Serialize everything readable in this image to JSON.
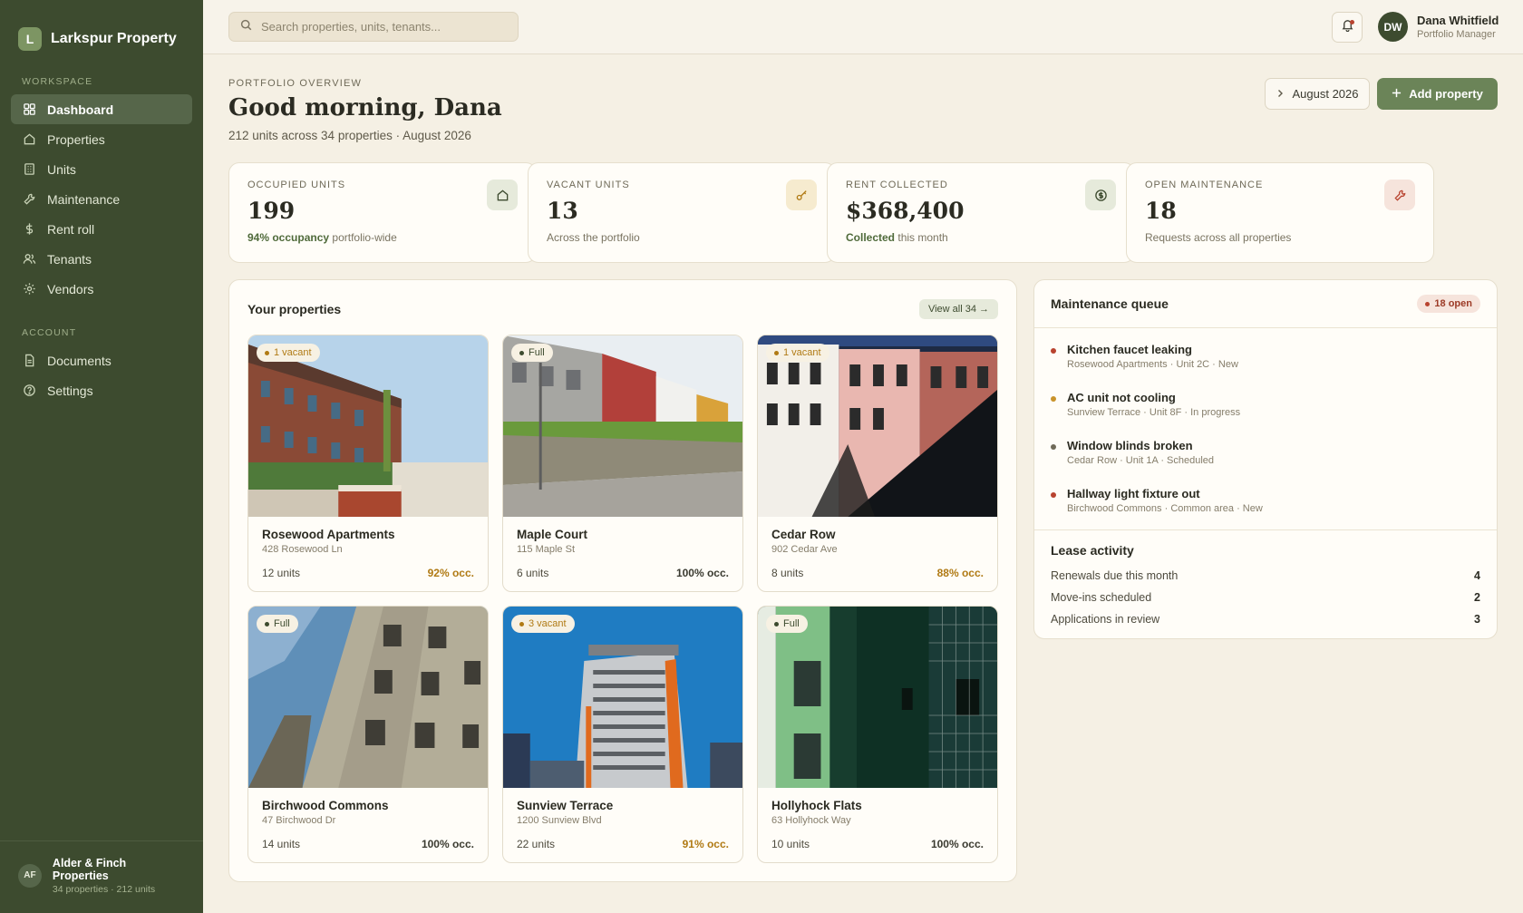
{
  "brand": {
    "initial": "L",
    "name": "Larkspur Property"
  },
  "sidebar": {
    "workspace_label": "WORKSPACE",
    "workspace_items": [
      {
        "label": "Dashboard",
        "icon": "grid-icon",
        "active": true
      },
      {
        "label": "Properties",
        "icon": "home-icon"
      },
      {
        "label": "Units",
        "icon": "building-icon"
      },
      {
        "label": "Maintenance",
        "icon": "wrench-icon"
      },
      {
        "label": "Rent roll",
        "icon": "dollar-icon"
      },
      {
        "label": "Tenants",
        "icon": "users-icon"
      },
      {
        "label": "Vendors",
        "icon": "gear-icon"
      }
    ],
    "account_label": "ACCOUNT",
    "account_items": [
      {
        "label": "Documents",
        "icon": "document-icon"
      },
      {
        "label": "Settings",
        "icon": "help-icon"
      }
    ],
    "footer": {
      "initials": "AF",
      "name": "Alder & Finch Properties",
      "sub": "34 properties · 212 units"
    }
  },
  "topbar": {
    "search_placeholder": "Search properties, units, tenants...",
    "user": {
      "initials": "DW",
      "name": "Dana Whitfield",
      "role": "Portfolio Manager"
    }
  },
  "header": {
    "eyebrow": "PORTFOLIO OVERVIEW",
    "greeting": "Good morning, Dana",
    "subline": "212 units across 34 properties · August 2026",
    "month_button": "August 2026",
    "add_button": "Add property"
  },
  "stats": [
    {
      "label": "OCCUPIED UNITS",
      "value": "199",
      "note_strong": "94% occupancy",
      "note": "portfolio-wide",
      "icon": "home-icon",
      "icon_bg": "#e6eadb",
      "icon_color": "#3d4b2f"
    },
    {
      "label": "VACANT UNITS",
      "value": "13",
      "note_strong": "",
      "note": "Across the portfolio",
      "icon": "key-icon",
      "icon_bg": "#f6ebcf",
      "icon_color": "#b07a14"
    },
    {
      "label": "RENT COLLECTED",
      "value": "$368,400",
      "note_strong": "Collected",
      "note": "this month",
      "icon": "dollar-circle-icon",
      "icon_bg": "#e6eadb",
      "icon_color": "#3d4b2f"
    },
    {
      "label": "OPEN MAINTENANCE",
      "value": "18",
      "note_strong": "",
      "note": "Requests across all properties",
      "icon": "wrench-icon",
      "icon_bg": "#f6e4dc",
      "icon_color": "#b8432f"
    }
  ],
  "properties_panel": {
    "title": "Your properties",
    "view_all": "View all 34 →",
    "items": [
      {
        "name": "Rosewood Apartments",
        "address": "428 Rosewood Ln",
        "units": "12 units",
        "occupancy": "92% occ.",
        "badge": "1 vacant",
        "status": "vacant"
      },
      {
        "name": "Maple Court",
        "address": "115 Maple St",
        "units": "6 units",
        "occupancy": "100% occ.",
        "badge": "Full",
        "status": "full"
      },
      {
        "name": "Cedar Row",
        "address": "902 Cedar Ave",
        "units": "8 units",
        "occupancy": "88% occ.",
        "badge": "1 vacant",
        "status": "vacant"
      },
      {
        "name": "Birchwood Commons",
        "address": "47 Birchwood Dr",
        "units": "14 units",
        "occupancy": "100% occ.",
        "badge": "Full",
        "status": "full"
      },
      {
        "name": "Sunview Terrace",
        "address": "1200 Sunview Blvd",
        "units": "22 units",
        "occupancy": "91% occ.",
        "badge": "3 vacant",
        "status": "vacant"
      },
      {
        "name": "Hollyhock Flats",
        "address": "63 Hollyhock Way",
        "units": "10 units",
        "occupancy": "100% occ.",
        "badge": "Full",
        "status": "full"
      }
    ]
  },
  "maintenance": {
    "title": "Maintenance queue",
    "badge": "18 open",
    "items": [
      {
        "title": "Kitchen faucet leaking",
        "sub": "Rosewood Apartments · Unit 2C · New",
        "color": "#b8432f"
      },
      {
        "title": "AC unit not cooling",
        "sub": "Sunview Terrace · Unit 8F · In progress",
        "color": "#c9932a"
      },
      {
        "title": "Window blinds broken",
        "sub": "Cedar Row · Unit 1A · Scheduled",
        "color": "#6f6a58"
      },
      {
        "title": "Hallway light fixture out",
        "sub": "Birchwood Commons · Common area · New",
        "color": "#b8432f"
      }
    ]
  },
  "lease": {
    "title": "Lease activity",
    "rows": [
      {
        "label": "Renewals due this month",
        "value": "4"
      },
      {
        "label": "Move-ins scheduled",
        "value": "2"
      },
      {
        "label": "Applications in review",
        "value": "3"
      }
    ]
  },
  "colors": {
    "accent": "#6b8458",
    "sidebar": "#3d4b2f",
    "vacant": "#b07a14",
    "full": "#3d4b2f"
  }
}
